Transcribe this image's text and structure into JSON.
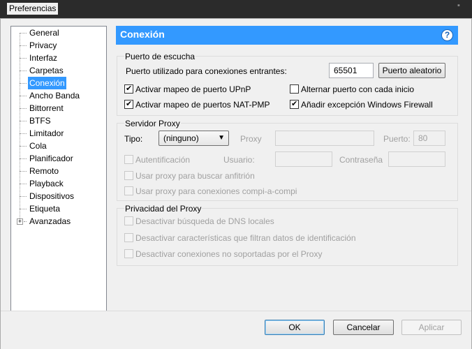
{
  "window": {
    "title": "Preferencias"
  },
  "sidebar": {
    "items": [
      {
        "label": "General"
      },
      {
        "label": "Privacy"
      },
      {
        "label": "Interfaz"
      },
      {
        "label": "Carpetas"
      },
      {
        "label": "Conexión",
        "selected": true
      },
      {
        "label": "Ancho Banda"
      },
      {
        "label": "Bittorrent"
      },
      {
        "label": "BTFS"
      },
      {
        "label": "Limitador"
      },
      {
        "label": "Cola"
      },
      {
        "label": "Planificador"
      },
      {
        "label": "Remoto"
      },
      {
        "label": "Playback"
      },
      {
        "label": "Dispositivos"
      },
      {
        "label": "Etiqueta"
      },
      {
        "label": "Avanzadas",
        "expandable": true
      }
    ]
  },
  "header": {
    "title": "Conexión",
    "help_icon": "?"
  },
  "listening_port": {
    "title": "Puerto de escucha",
    "port_label": "Puerto utilizado para conexiones entrantes:",
    "port_value": "65501",
    "random_port_button": "Puerto aleatorio",
    "upnp_label": "Activar mapeo de puerto UPnP",
    "upnp_checked": true,
    "natpmp_label": "Activar mapeo de puertos NAT-PMP",
    "natpmp_checked": true,
    "alternate_label": "Alternar puerto con cada inicio",
    "alternate_checked": false,
    "firewall_label": "Añadir excepción Windows Firewall",
    "firewall_checked": true
  },
  "proxy_server": {
    "title": "Servidor Proxy",
    "type_label": "Tipo:",
    "type_value": "(ninguno)",
    "proxy_label": "Proxy",
    "proxy_value": "",
    "port_label": "Puerto:",
    "port_value": "80",
    "auth_label": "Autentificación",
    "user_label": "Usuario:",
    "password_label": "Contraseña",
    "hostname_label": "Usar proxy para buscar anfitrión",
    "p2p_label": "Usar proxy para conexiones compi-a-compi"
  },
  "proxy_privacy": {
    "title": "Privacidad del Proxy",
    "dns_label": "Desactivar búsqueda de DNS locales",
    "features_label": "Desactivar características que filtran datos de identificación",
    "unsupported_label": "Desactivar conexiones no soportadas por el Proxy"
  },
  "buttons": {
    "ok": "OK",
    "cancel": "Cancelar",
    "apply": "Aplicar"
  }
}
